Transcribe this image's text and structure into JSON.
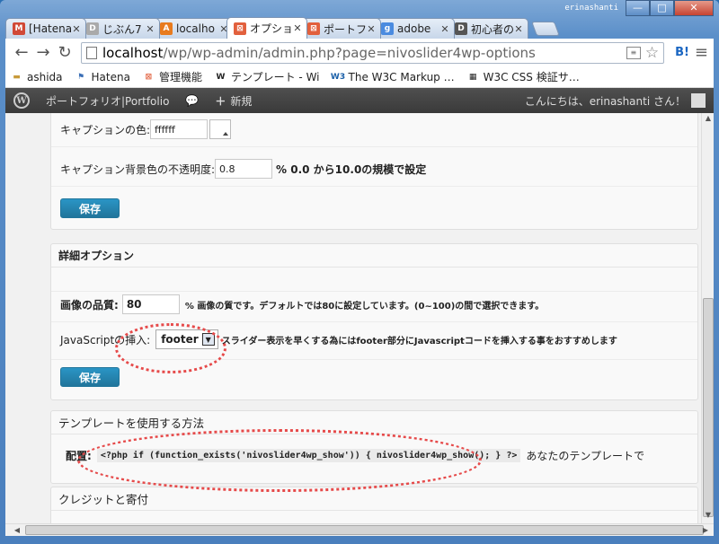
{
  "window": {
    "user_label": "erinashanti",
    "controls": {
      "minimize": "—",
      "maximize": "□",
      "close": "✕"
    }
  },
  "tabs": [
    {
      "label": "[Hatena",
      "icon": "gmail-icon",
      "color": "#d14836",
      "glyph": "M"
    },
    {
      "label": "じぶん7",
      "icon": "document-icon",
      "color": "#aaaaaa",
      "glyph": "D"
    },
    {
      "label": "localho",
      "icon": "phpmyadmin-icon",
      "color": "#e87b1e",
      "glyph": "A"
    },
    {
      "label": "オプショ",
      "icon": "wp-plugin-icon",
      "color": "#e2603d",
      "glyph": "⊠",
      "active": true
    },
    {
      "label": "ポートフ",
      "icon": "wp-plugin-icon",
      "color": "#e2603d",
      "glyph": "⊠"
    },
    {
      "label": "adobe",
      "icon": "google-icon",
      "color": "#4a8be0",
      "glyph": "g"
    },
    {
      "label": "初心者の",
      "icon": "document-icon",
      "color": "#555555",
      "glyph": "D"
    }
  ],
  "toolbar": {
    "back": "←",
    "forward": "→",
    "reload": "↻",
    "url_host": "localhost",
    "url_rest": "/wp/wp-admin/admin.php?page=nivoslider4wp-options",
    "star": "☆",
    "ext_label": "B!",
    "menu": "≡"
  },
  "bookmarks": [
    {
      "label": "ashida",
      "icon": "folder-icon",
      "glyph": "▬",
      "color": "#c89a3a"
    },
    {
      "label": "Hatena",
      "icon": "hatena-icon",
      "glyph": "⚑",
      "color": "#3b6fb6"
    },
    {
      "label": "管理機能",
      "icon": "wp-plugin-icon",
      "glyph": "⊠",
      "color": "#e2603d"
    },
    {
      "label": "テンプレート - Wi",
      "icon": "wikipedia-icon",
      "glyph": "W",
      "color": "#222222"
    },
    {
      "label": "The W3C Markup …",
      "icon": "w3c-icon",
      "glyph": "W3",
      "color": "#1a5fa8"
    },
    {
      "label": "W3C CSS 検証サ…",
      "icon": "w3c-css-icon",
      "glyph": "▦",
      "color": "#222222"
    }
  ],
  "adminbar": {
    "logo": "W",
    "site_name": "ポートフォリオ|Portfolio",
    "comments_icon": "💬",
    "new_label": "新規",
    "new_icon": "＋",
    "greeting": "こんにちは、erinashanti さん！"
  },
  "caption_section": {
    "color_label": "キャプションの色:",
    "color_value": "ffffff",
    "opacity_label": "キャプション背景色の不透明度:",
    "opacity_value": "0.8",
    "opacity_hint": "% 0.0 から10.0の規模で設定",
    "save_label": "保存"
  },
  "advanced_section": {
    "title": "詳細オプション",
    "quality_label": "画像の品質:",
    "quality_value": "80",
    "quality_hint": "%  画像の質です。デフォルトでは80に設定しています。(0~100)の間で選択できます。",
    "js_label": "JavaScriptの挿入:",
    "js_value": "footer",
    "js_hint": "スライダー表示を早くする為にはfooter部分にJavascriptコードを挿入する事をおすすめします",
    "save_label": "保存"
  },
  "template_section": {
    "title": "テンプレートを使用する方法",
    "place_label": "配置:",
    "code": "<?php if (function_exists('nivoslider4wp_show')) { nivoslider4wp_show(); } ?>",
    "suffix": "あなたのテンプレートで"
  },
  "credits_section": {
    "title": "クレジットと寄付"
  },
  "colors": {
    "primary_button": "#21759b",
    "annotation": "#e64a4a",
    "adminbar": "#464646"
  }
}
